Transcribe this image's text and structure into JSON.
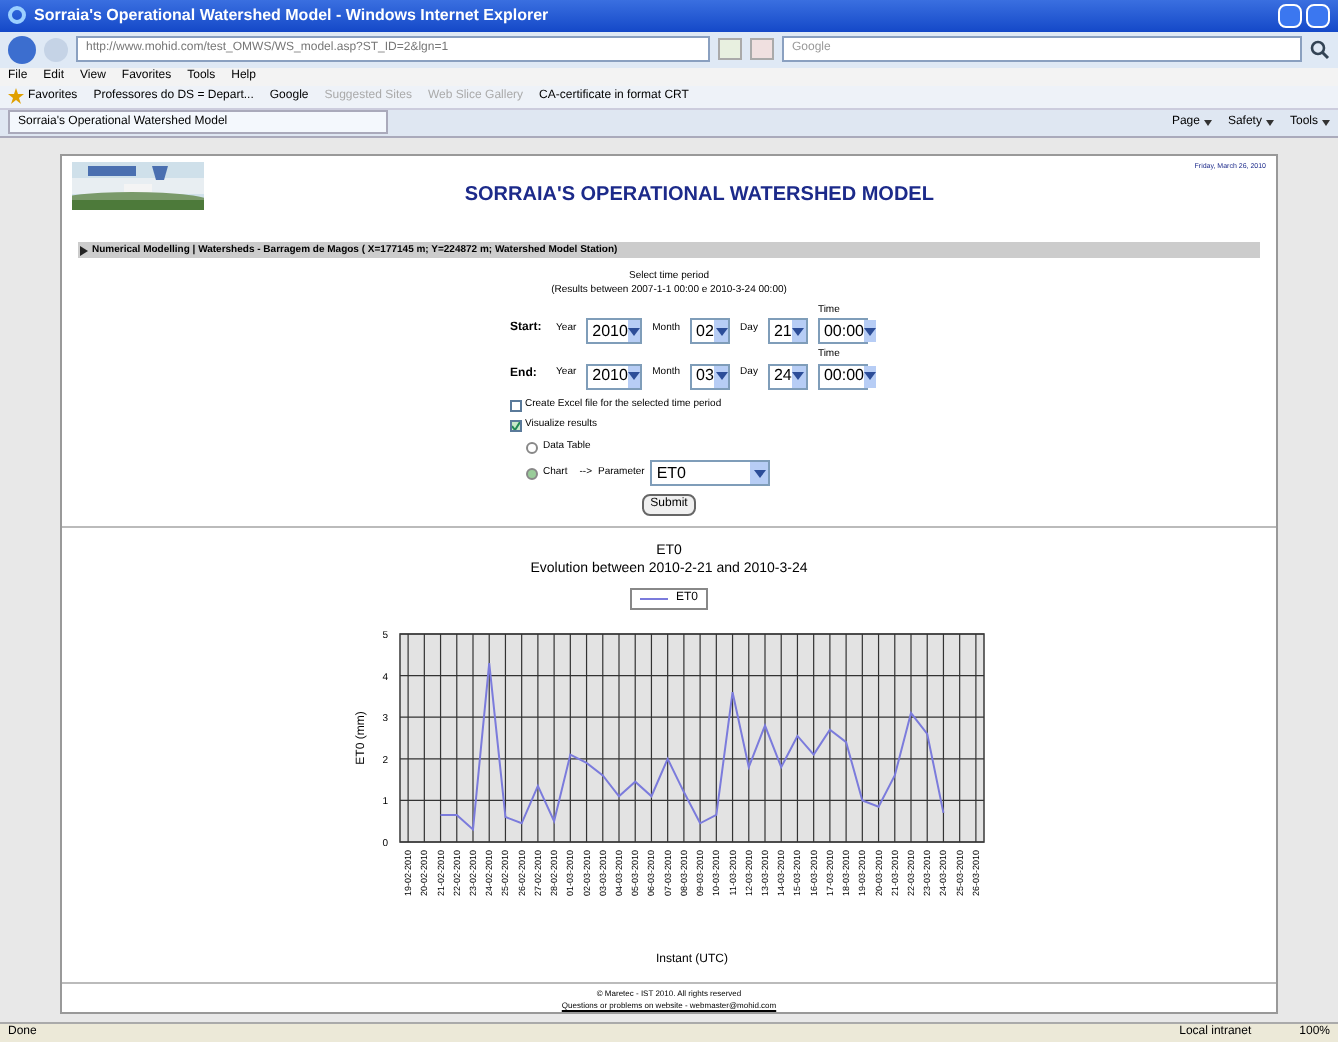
{
  "window": {
    "title": "Sorraia's Operational Watershed Model - Windows Internet Explorer"
  },
  "address_bar": {
    "url": "http://www.mohid.com/test_OMWS/WS_model.asp?ST_ID=2&lgn=1",
    "search_placeholder": "Google"
  },
  "menu": [
    "File",
    "Edit",
    "View",
    "Favorites",
    "Tools",
    "Help"
  ],
  "favorites_bar": {
    "label": "Favorites",
    "items": [
      "Professores do DS = Depart...",
      "Google",
      "Suggested Sites",
      "Web Slice Gallery",
      "CA-certificate in format CRT"
    ]
  },
  "tab": {
    "title": "Sorraia's Operational Watershed Model"
  },
  "command_bar": [
    "Page",
    "Safety",
    "Tools"
  ],
  "page": {
    "title": "SORRAIA'S OPERATIONAL WATERSHED MODEL",
    "date": "Friday, March 26, 2010",
    "breadcrumb": "Numerical Modelling | Watersheds - Barragem de Magos ( X=177145 m; Y=224872 m; Watershed Model Station)",
    "form": {
      "heading": "Select time period",
      "range_note": "(Results between 2007-1-1 00:00 e 2010-3-24 00:00)",
      "rows": [
        {
          "label": "Start:",
          "year_label": "Year",
          "year": "2010",
          "month_label": "Month",
          "month": "02",
          "day_label": "Day",
          "day": "21",
          "time_label": "Time",
          "time": "00:00"
        },
        {
          "label": "End:",
          "year_label": "Year",
          "year": "2010",
          "month_label": "Month",
          "month": "03",
          "day_label": "Day",
          "day": "24",
          "time_label": "Time",
          "time": "00:00"
        }
      ],
      "excel": {
        "label": "Create Excel file for the selected time period",
        "checked": false
      },
      "visualize": {
        "label": "Visualize results",
        "checked": true
      },
      "options": [
        {
          "label": "Data Table",
          "selected": false
        },
        {
          "label": "Chart",
          "selected": true
        }
      ],
      "arrow": "-->",
      "parameter_label": "Parameter",
      "parameter": "ET0",
      "submit": "Submit"
    },
    "chart": {
      "subtitle": "Evolution between 2010-2-21 and 2010-3-24",
      "chart_data": {
        "type": "line",
        "title": "ET0",
        "xlabel": "Instant (UTC)",
        "ylabel": "ET0 (mm)",
        "categories": [
          "19-02-2010",
          "20-02-2010",
          "21-02-2010",
          "22-02-2010",
          "23-02-2010",
          "24-02-2010",
          "25-02-2010",
          "26-02-2010",
          "27-02-2010",
          "28-02-2010",
          "01-03-2010",
          "02-03-2010",
          "03-03-2010",
          "04-03-2010",
          "05-03-2010",
          "06-03-2010",
          "07-03-2010",
          "08-03-2010",
          "09-03-2010",
          "10-03-2010",
          "11-03-2010",
          "12-03-2010",
          "13-03-2010",
          "14-03-2010",
          "15-03-2010",
          "16-03-2010",
          "17-03-2010",
          "18-03-2010",
          "19-03-2010",
          "20-03-2010",
          "21-03-2010",
          "22-03-2010",
          "23-03-2010",
          "24-03-2010",
          "25-03-2010",
          "26-03-2010"
        ],
        "series": [
          {
            "name": "ET0",
            "color": "#7b7bdc",
            "values": [
              null,
              null,
              0.65,
              0.65,
              0.3,
              4.3,
              0.6,
              0.45,
              1.35,
              0.5,
              2.1,
              1.9,
              1.6,
              1.1,
              1.45,
              1.1,
              2.0,
              1.2,
              0.45,
              0.65,
              3.6,
              1.8,
              2.8,
              1.8,
              2.55,
              2.1,
              2.7,
              2.4,
              1.0,
              0.85,
              1.6,
              3.1,
              2.6,
              0.7,
              null,
              null
            ]
          }
        ],
        "grid": true,
        "ylim": [
          0,
          5
        ],
        "yticks": [
          0,
          1,
          2,
          3,
          4,
          5
        ]
      }
    },
    "footer": {
      "copyright": "© Maretec - IST 2010. All rights reserved",
      "contact": "Questions or problems on website - webmaster@mohid.com"
    }
  },
  "status_bar": {
    "status": "Done",
    "zone": "Local intranet",
    "zoom": "100%"
  }
}
